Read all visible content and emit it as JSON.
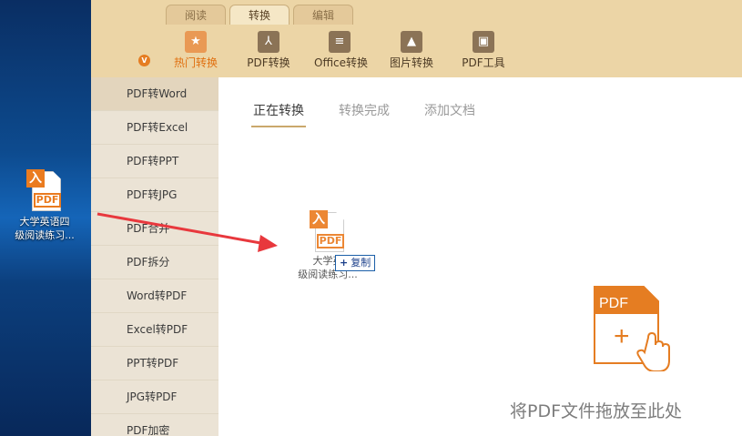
{
  "desktop": {
    "file_label_line1": "大学英语四",
    "file_label_line2": "级阅读练习...",
    "file_badge": "入",
    "file_type_text": "PDF"
  },
  "toolbar": {
    "tabs": [
      {
        "label": "阅读",
        "active": false
      },
      {
        "label": "转换",
        "active": true
      },
      {
        "label": "编辑",
        "active": false
      }
    ],
    "vip_badge": "V",
    "tools": [
      {
        "label": "热门转换",
        "icon": "star-icon",
        "active": true
      },
      {
        "label": "PDF转换",
        "icon": "pdf-convert-icon",
        "active": false
      },
      {
        "label": "Office转换",
        "icon": "office-convert-icon",
        "active": false
      },
      {
        "label": "图片转换",
        "icon": "image-convert-icon",
        "active": false
      },
      {
        "label": "PDF工具",
        "icon": "toolbox-icon",
        "active": false
      }
    ]
  },
  "sidebar": {
    "items": [
      {
        "label": "PDF转Word",
        "active": true
      },
      {
        "label": "PDF转Excel",
        "active": false
      },
      {
        "label": "PDF转PPT",
        "active": false
      },
      {
        "label": "PDF转JPG",
        "active": false
      },
      {
        "label": "PDF合并",
        "active": false
      },
      {
        "label": "PDF拆分",
        "active": false
      },
      {
        "label": "Word转PDF",
        "active": false
      },
      {
        "label": "Excel转PDF",
        "active": false
      },
      {
        "label": "PPT转PDF",
        "active": false
      },
      {
        "label": "JPG转PDF",
        "active": false
      },
      {
        "label": "PDF加密",
        "active": false
      }
    ]
  },
  "main": {
    "tabs": [
      {
        "label": "正在转换",
        "active": true
      },
      {
        "label": "转换完成",
        "active": false
      },
      {
        "label": "添加文档",
        "active": false
      }
    ],
    "dragged_file": {
      "label_line1": "大学英",
      "label_line2": "级阅读练习...",
      "type_text": "PDF",
      "badge": "入"
    },
    "copy_tooltip": {
      "plus": "+",
      "text": "复制"
    },
    "drop_icon": {
      "label": "PDF",
      "plus": "+"
    },
    "drop_hint": "将PDF文件拖放至此处"
  },
  "colors": {
    "accent": "#e57d22",
    "toolbar_bg": "#ecd5a6",
    "sidebar_bg": "#ebe3d5",
    "arrow": "#e8383d"
  }
}
